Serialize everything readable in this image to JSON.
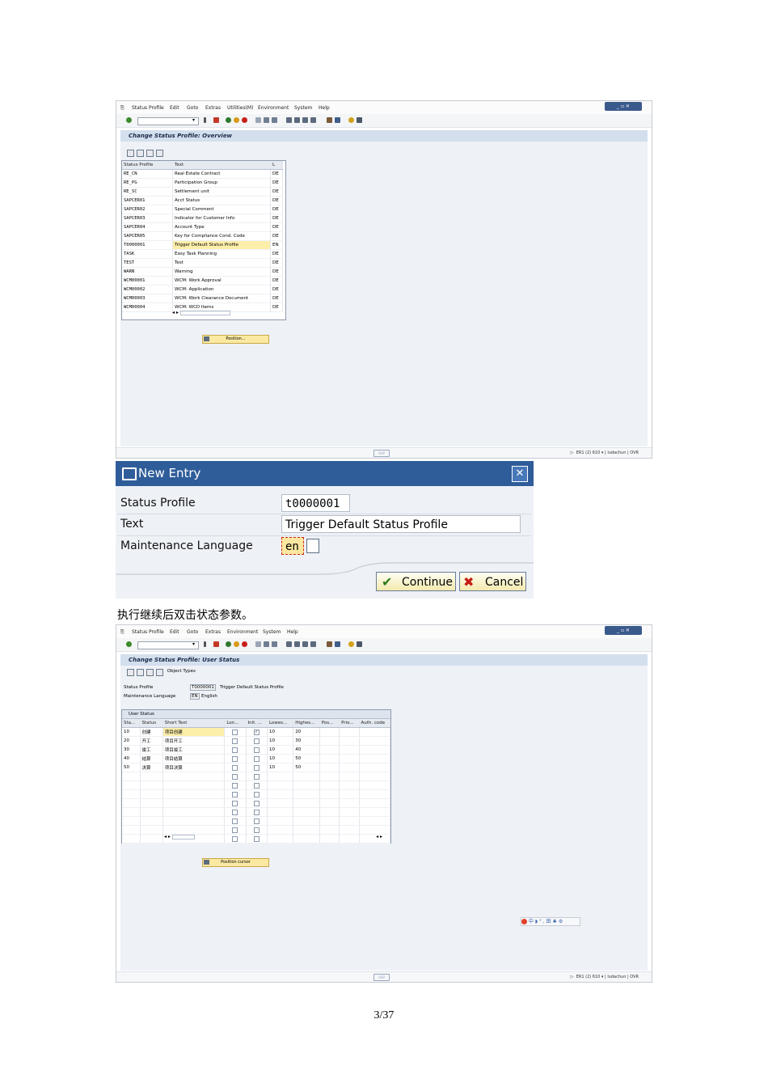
{
  "window1": {
    "menu": [
      "Status Profile",
      "Edit",
      "Goto",
      "Extras",
      "Utilities(M)",
      "Environment",
      "System",
      "Help"
    ],
    "title": "Change Status Profile: Overview",
    "table": {
      "headers": [
        "Status Profile",
        "Text",
        "L"
      ],
      "rows": [
        [
          "RE_CN",
          "Real Estate Contract",
          "DE"
        ],
        [
          "RE_PG",
          "Participation Group",
          "DE"
        ],
        [
          "RE_SC",
          "Settlement unit",
          "DE"
        ],
        [
          "SAPCER01",
          "Acct Status",
          "DE"
        ],
        [
          "SAPCER02",
          "Special Comment",
          "DE"
        ],
        [
          "SAPCER03",
          "Indicator for Customer Info",
          "DE"
        ],
        [
          "SAPCER04",
          "Account Type",
          "DE"
        ],
        [
          "SAPCER05",
          "Key for Compliance Cond. Code",
          "DE"
        ],
        [
          "T0000001",
          "Trigger Default Status Profile",
          "EN"
        ],
        [
          "TASK",
          "Easy Task Planning",
          "DE"
        ],
        [
          "TEST",
          "Test",
          "DE"
        ],
        [
          "WARN",
          "Warning",
          "DE"
        ],
        [
          "WCM00001",
          "WCM: Work Approval",
          "DE"
        ],
        [
          "WCM00002",
          "WCM: Application",
          "DE"
        ],
        [
          "WCM00003",
          "WCM: Work Clearance Document",
          "DE"
        ],
        [
          "WCM00004",
          "WCM: WCD Items",
          "DE"
        ]
      ]
    },
    "position_button": "Position...",
    "status_right": "ER1 (2) 610",
    "status_user": "ludachun",
    "status_mode": "OVR"
  },
  "dialog": {
    "title": "New Entry",
    "close": "✕",
    "labels": {
      "status_profile": "Status Profile",
      "text": "Text",
      "language": "Maintenance Language"
    },
    "values": {
      "status_profile": "t0000001",
      "text": "Trigger Default Status Profile",
      "language": "en"
    },
    "continue": "Continue",
    "cancel": "Cancel"
  },
  "caption": "执行继续后双击状态参数。",
  "window2": {
    "menu": [
      "Status Profile",
      "Edit",
      "Goto",
      "Extras",
      "Environment",
      "System",
      "Help"
    ],
    "title": "Change Status Profile: User Status",
    "app_toolbar_label": "Object Types",
    "fields": {
      "profile_label": "Status Profile",
      "profile_value": "T0000001",
      "profile_text": "Trigger Default Status Profile",
      "lang_label": "Maintenance Language",
      "lang_value": "EN",
      "lang_text": "English"
    },
    "table_title": "User Status",
    "headers": [
      "Sta...",
      "Status",
      "Short Text",
      "Lon...",
      "Init. ...",
      "Lowes...",
      "Highes...",
      "Pos...",
      "Prio...",
      "Auth. code"
    ],
    "rows": [
      [
        "10",
        "创建",
        "项目创建",
        "",
        "✓",
        "10",
        "20"
      ],
      [
        "20",
        "开工",
        "项目开工",
        "",
        "",
        "10",
        "30"
      ],
      [
        "30",
        "竣工",
        "项目竣工",
        "",
        "",
        "10",
        "40"
      ],
      [
        "40",
        "结算",
        "项目结算",
        "",
        "",
        "10",
        "50"
      ],
      [
        "50",
        "决算",
        "项目决算",
        "",
        "",
        "10",
        "50"
      ]
    ],
    "position_button": "Position cursor",
    "ime": "中 ◗ ° , 田 ♣ ⚙",
    "status_right": "ER1 (2) 610",
    "status_user": "ludachun",
    "status_mode": "OVR"
  },
  "page_number": "3/37"
}
